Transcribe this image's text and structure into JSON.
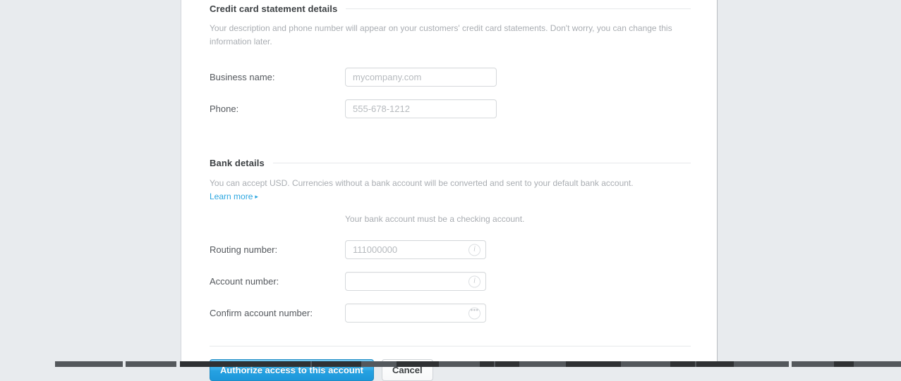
{
  "statement_section": {
    "title": "Credit card statement details",
    "description": "Your description and phone number will appear on your customers' credit card statements. Don't worry, you can change this information later.",
    "fields": [
      {
        "label": "Business name:",
        "value": "",
        "placeholder": "mycompany.com"
      },
      {
        "label": "Phone:",
        "value": "",
        "placeholder": "555-678-1212"
      }
    ]
  },
  "bank_section": {
    "title": "Bank details",
    "description": "You can accept USD. Currencies without a bank account will be converted and sent to your default bank account.",
    "learn_more_label": "Learn more",
    "learn_more_arrow": "▸",
    "helper_note": "Your bank account must be a checking account.",
    "fields": [
      {
        "label": "Routing number:",
        "value": "",
        "placeholder": "111000000",
        "icon": "info-icon",
        "icon_glyph": "i"
      },
      {
        "label": "Account number:",
        "value": "",
        "placeholder": "",
        "icon": "info-icon",
        "icon_glyph": "i"
      },
      {
        "label": "Confirm account number:",
        "value": "",
        "placeholder": "",
        "icon": "ellipsis-icon",
        "icon_glyph": "•••"
      }
    ]
  },
  "actions": {
    "primary_label": "Authorize access to this account",
    "secondary_label": "Cancel"
  },
  "colors": {
    "page_background": "#e8ebee",
    "panel_background": "#ffffff",
    "link_blue": "#2ba6e0",
    "primary_button": "#26a2e2",
    "heading_text": "#3c4043",
    "muted_text": "#a9adb2"
  }
}
